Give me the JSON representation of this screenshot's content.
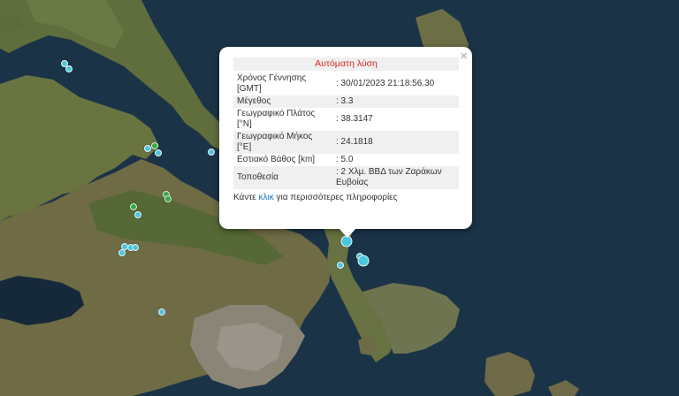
{
  "popup": {
    "title": "Αυτόματη λύση",
    "close_symbol": "×",
    "rows": [
      {
        "label": "Χρόνος Γέννησης [GMT]",
        "value": ": 30/01/2023 21:18:56.30"
      },
      {
        "label": "Μέγεθος",
        "value": ": 3.3"
      },
      {
        "label": "Γεωγραφικό Πλάτος [°N]",
        "value": ": 38.3147"
      },
      {
        "label": "Γεωγραφικό Μήκος [°E]",
        "value": ": 24.1818"
      },
      {
        "label": "Εστιακό Βάθος [km]",
        "value": ": 5.0"
      },
      {
        "label": "Τοποθεσία",
        "value": ": 2 Χλμ. ΒΒΔ των Ζαράκων Ευβοίας"
      }
    ],
    "footer_prefix": "Κάντε ",
    "footer_link": "κλικ",
    "footer_suffix": " για περισσότερες πληροφορίες"
  },
  "colors": {
    "sea": "#1b3346",
    "marker": "#4cc6dc",
    "marker_green": "#3aa84a",
    "popup_title": "#d9262a",
    "link": "#1a73c8"
  }
}
